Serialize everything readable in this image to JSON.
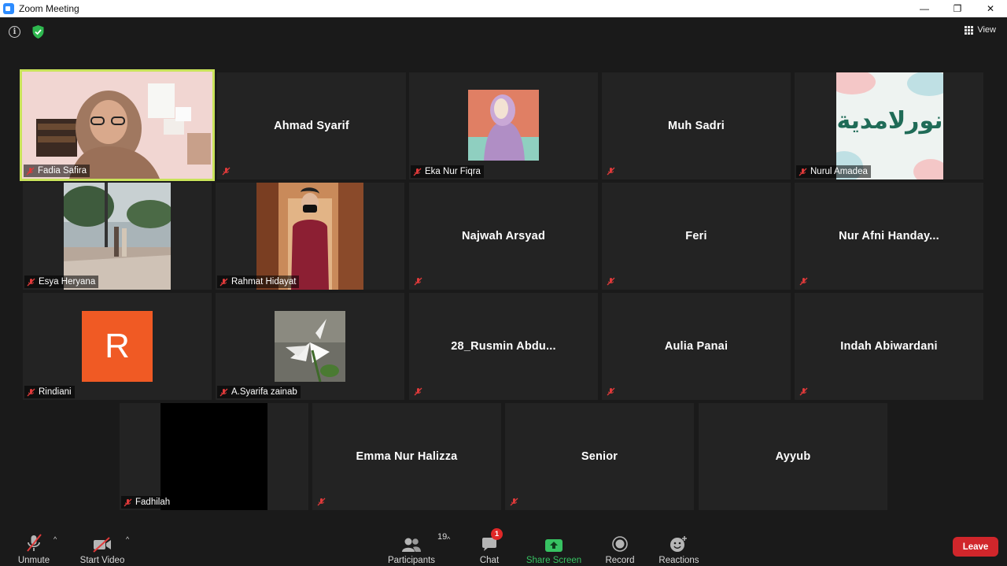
{
  "window": {
    "title": "Zoom Meeting",
    "minimize": "—",
    "restore": "❐",
    "close": "✕"
  },
  "topbar": {
    "info_glyph": "i",
    "view_label": "View"
  },
  "tiles": [
    {
      "name": "Fadia Safira"
    },
    {
      "name": "Ahmad Syarif"
    },
    {
      "name": "Eka Nur Fiqra"
    },
    {
      "name": "Muh Sadri"
    },
    {
      "name": "Nurul Amadea",
      "arabic": "نورلامدية"
    },
    {
      "name": "Esya Heryana"
    },
    {
      "name": "Rahmat Hidayat"
    },
    {
      "name": "Najwah Arsyad"
    },
    {
      "name": "Feri"
    },
    {
      "name": "Nur Afni Handay..."
    },
    {
      "name": "Rindiani",
      "avatar_letter": "R"
    },
    {
      "name": "A.Syarifa zainab"
    },
    {
      "name": "28_Rusmin Abdu..."
    },
    {
      "name": "Aulia Panai"
    },
    {
      "name": "Indah Abiwardani"
    },
    {
      "name": "Fadhilah"
    },
    {
      "name": "Emma Nur Halizza"
    },
    {
      "name": "Senior"
    },
    {
      "name": "Ayyub"
    }
  ],
  "toolbar": {
    "unmute": "Unmute",
    "start_video": "Start Video",
    "participants": "Participants",
    "participants_count": "19",
    "chat": "Chat",
    "chat_badge": "1",
    "share": "Share Screen",
    "record": "Record",
    "reactions": "Reactions",
    "leave": "Leave",
    "caret": "^"
  },
  "colors": {
    "active_speaker_border": "#c9e35a",
    "leave": "#d0262b",
    "share": "#37c262",
    "muted_icon": "#e03a3a"
  }
}
